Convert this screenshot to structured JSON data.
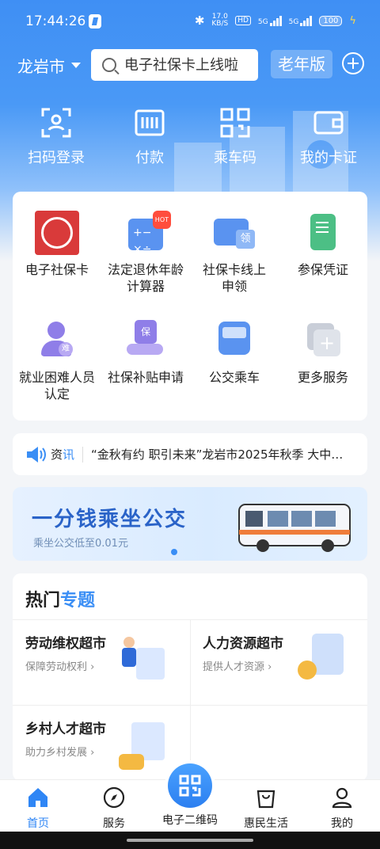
{
  "status": {
    "time": "17:44:26",
    "net_speed": "17.0",
    "net_unit": "KB/S",
    "hd": "HD",
    "sig1": "5G",
    "sig2": "5G",
    "battery": "100"
  },
  "topbar": {
    "city": "龙岩市",
    "search_placeholder": "电子社保卡上线啦",
    "elder_mode": "老年版"
  },
  "quick": [
    "扫码登录",
    "付款",
    "乘车码",
    "我的卡证"
  ],
  "services": [
    {
      "label": "电子社保卡"
    },
    {
      "label": "法定退休年龄计算器",
      "badge": "HOT"
    },
    {
      "label": "社保卡线上申领",
      "badge_char": "领"
    },
    {
      "label": "参保凭证"
    },
    {
      "label": "就业困难人员认定",
      "badge_char": "难"
    },
    {
      "label": "社保补贴申请",
      "badge_char": "保"
    },
    {
      "label": "公交乘车"
    },
    {
      "label": "更多服务"
    }
  ],
  "news": {
    "tag_a": "资",
    "tag_b": "讯",
    "text": "“金秋有约 职引未来”龙岩市2025年秋季 大中…"
  },
  "banner": {
    "title": "一分钱乘坐公交",
    "subtitle": "乘坐公交低至0.01元"
  },
  "topics": {
    "heading_a": "热门",
    "heading_b": "专题",
    "items": [
      {
        "title": "劳动维权超市",
        "sub": "保障劳动权利"
      },
      {
        "title": "人力资源超市",
        "sub": "提供人才资源"
      },
      {
        "title": "乡村人才超市",
        "sub": "助力乡村发展"
      }
    ]
  },
  "tabs": [
    "首页",
    "服务",
    "电子二维码",
    "惠民生活",
    "我的"
  ],
  "colors": {
    "brand_blue": "#3a8ef5",
    "hero_blue": "#3f8ff4"
  }
}
